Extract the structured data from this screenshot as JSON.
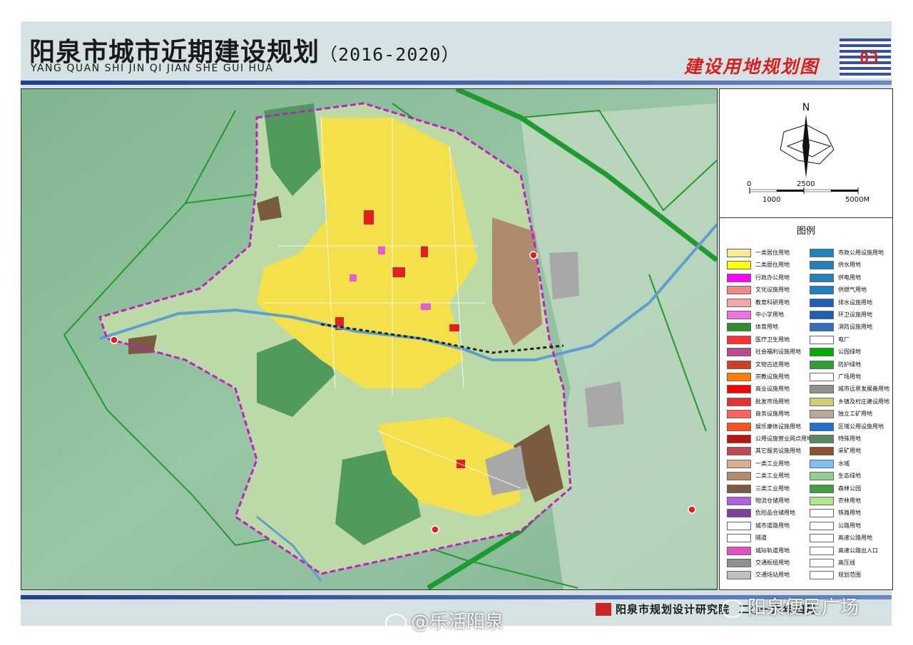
{
  "header": {
    "title": "阳泉市城市近期建设规划",
    "years": "（2016-2020）",
    "pinyin": "YANG QUAN SHI JIN QI JIAN SHE GUI HUA",
    "map_name": "建设用地规划图",
    "map_number": "03"
  },
  "compass": {
    "north": "N"
  },
  "scale": {
    "labels": [
      "0",
      "2500",
      "1000",
      "5000M"
    ]
  },
  "legend": {
    "title": "图例",
    "left": [
      {
        "label": "一类居住用地",
        "color": "#fde89a"
      },
      {
        "label": "二类居住用地",
        "color": "#ffff00"
      },
      {
        "label": "行政办公用地",
        "color": "#ff00ff"
      },
      {
        "label": "文化设施用地",
        "color": "#f08a8a"
      },
      {
        "label": "教育科研用地",
        "color": "#f5a6a6"
      },
      {
        "label": "中小学用地",
        "color": "#f070e0"
      },
      {
        "label": "体育用地",
        "color": "#2e8b2e"
      },
      {
        "label": "医疗卫生用地",
        "color": "#ff3030"
      },
      {
        "label": "社会福利设施用地",
        "color": "#c04890"
      },
      {
        "label": "文物古迹用地",
        "color": "#d04020"
      },
      {
        "label": "宗教设施用地",
        "color": "#ff8000"
      },
      {
        "label": "商业设施用地",
        "color": "#ff0000"
      },
      {
        "label": "批发市场用地",
        "color": "#e83030"
      },
      {
        "label": "商务设施用地",
        "color": "#ff6060"
      },
      {
        "label": "娱乐康体设施用地",
        "color": "#ff5020"
      },
      {
        "label": "公用设施营业网点用地",
        "color": "#c01010"
      },
      {
        "label": "其它服务设施用地",
        "color": "#c04850"
      },
      {
        "label": "一类工业用地",
        "color": "#d8b090"
      },
      {
        "label": "二类工业用地",
        "color": "#b48a6a"
      },
      {
        "label": "三类工业用地",
        "color": "#7a5a40"
      },
      {
        "label": "物流仓储用地",
        "color": "#b060d8"
      },
      {
        "label": "危险品仓储用地",
        "color": "#8040a0"
      },
      {
        "label": "城市道路用地",
        "color": "#ffffff"
      },
      {
        "label": "隧道",
        "color": "#ffffff"
      },
      {
        "label": "城际轨道用地",
        "color": "#e050c0"
      },
      {
        "label": "交通枢纽用地",
        "color": "#909090"
      },
      {
        "label": "交通场站用地",
        "color": "#c0c0c0"
      }
    ],
    "right": [
      {
        "label": "市政公用设施用地",
        "color": "#2080c0"
      },
      {
        "label": "供水用地",
        "color": "#2080c0"
      },
      {
        "label": "供电用地",
        "color": "#2080c0"
      },
      {
        "label": "供燃气用地",
        "color": "#2080c0"
      },
      {
        "label": "排水设施用地",
        "color": "#2060b0"
      },
      {
        "label": "环卫设施用地",
        "color": "#2060b0"
      },
      {
        "label": "消防设施用地",
        "color": "#3070b8"
      },
      {
        "label": "电厂",
        "color": "#ffffff"
      },
      {
        "label": "公园绿地",
        "color": "#00b000"
      },
      {
        "label": "防护绿地",
        "color": "#30a030"
      },
      {
        "label": "广场用地",
        "color": "#ffffff"
      },
      {
        "label": "城市远景发展备用地",
        "color": "#909090"
      },
      {
        "label": "乡镇及村庄建设用地",
        "color": "#d0d070"
      },
      {
        "label": "独立工矿用地",
        "color": "#b8a898"
      },
      {
        "label": "区域公用设施用地",
        "color": "#2070d0"
      },
      {
        "label": "特殊用地",
        "color": "#5a8a5a"
      },
      {
        "label": "采矿用地",
        "color": "#8a5030"
      },
      {
        "label": "水域",
        "color": "#80c0f0"
      },
      {
        "label": "生态绿地",
        "color": "#90d090"
      },
      {
        "label": "森林公园",
        "color": "#40a040"
      },
      {
        "label": "农林用地",
        "color": "#b0e890"
      },
      {
        "label": "铁路用地",
        "color": "#ffffff"
      },
      {
        "label": "公路用地",
        "color": "#ffffff"
      },
      {
        "label": "高速公路用地",
        "color": "#ffffff"
      },
      {
        "label": "高速公路出入口",
        "color": "#ffffff"
      },
      {
        "label": "高压线",
        "color": "#ffffff"
      },
      {
        "label": "规划范围",
        "color": "#ffffff"
      }
    ]
  },
  "footer": {
    "institute": "阳泉市规划设计研究院",
    "date": "二○一六年四月"
  },
  "watermarks": {
    "weibo": "@乐活阳泉",
    "wechat": "阳泉便民广场"
  }
}
